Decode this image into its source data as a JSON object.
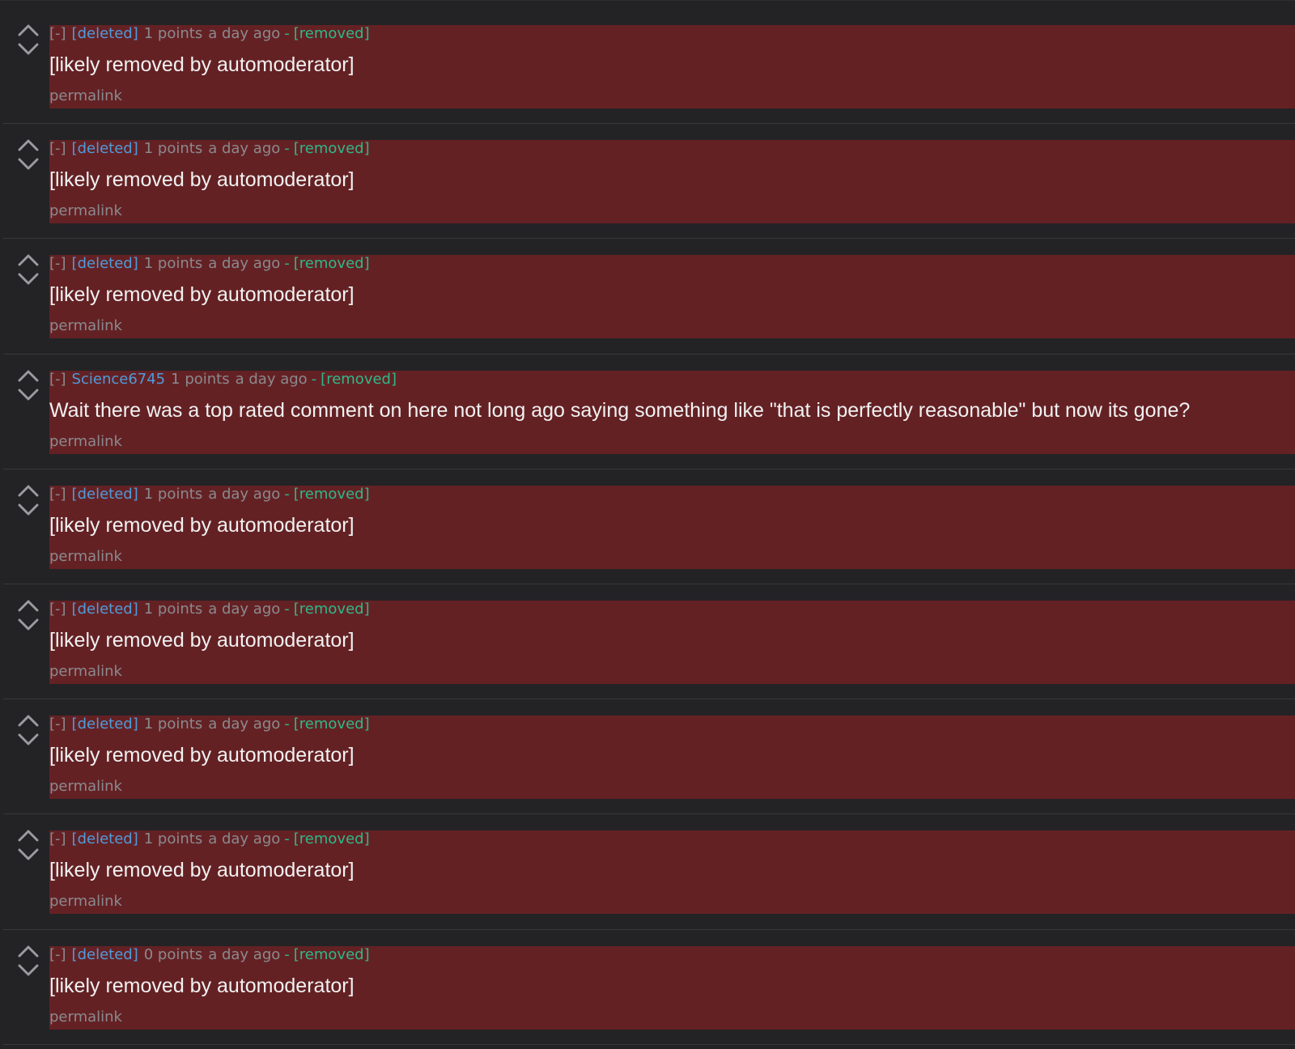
{
  "colors": {
    "page_background": "#232325",
    "removed_background": "#642124",
    "author_link": "#4f9bd9",
    "status_removed": "#2fb889",
    "meta_text": "#8a8a8e",
    "body_text": "#f1f1f1"
  },
  "comments": [
    {
      "expand": "[-]",
      "author": "[deleted]",
      "score": "1 points",
      "time": "a day ago",
      "dash": "-",
      "status": "[removed]",
      "text": "[likely removed by automoderator]",
      "permalink": "permalink"
    },
    {
      "expand": "[-]",
      "author": "[deleted]",
      "score": "1 points",
      "time": "a day ago",
      "dash": "-",
      "status": "[removed]",
      "text": "[likely removed by automoderator]",
      "permalink": "permalink"
    },
    {
      "expand": "[-]",
      "author": "[deleted]",
      "score": "1 points",
      "time": "a day ago",
      "dash": "-",
      "status": "[removed]",
      "text": "[likely removed by automoderator]",
      "permalink": "permalink"
    },
    {
      "expand": "[-]",
      "author": "Science6745",
      "score": "1 points",
      "time": "a day ago",
      "dash": "-",
      "status": "[removed]",
      "text": "Wait there was a top rated comment on here not long ago saying something like \"that is perfectly reasonable\" but now its gone?",
      "permalink": "permalink"
    },
    {
      "expand": "[-]",
      "author": "[deleted]",
      "score": "1 points",
      "time": "a day ago",
      "dash": "-",
      "status": "[removed]",
      "text": "[likely removed by automoderator]",
      "permalink": "permalink"
    },
    {
      "expand": "[-]",
      "author": "[deleted]",
      "score": "1 points",
      "time": "a day ago",
      "dash": "-",
      "status": "[removed]",
      "text": "[likely removed by automoderator]",
      "permalink": "permalink"
    },
    {
      "expand": "[-]",
      "author": "[deleted]",
      "score": "1 points",
      "time": "a day ago",
      "dash": "-",
      "status": "[removed]",
      "text": "[likely removed by automoderator]",
      "permalink": "permalink"
    },
    {
      "expand": "[-]",
      "author": "[deleted]",
      "score": "1 points",
      "time": "a day ago",
      "dash": "-",
      "status": "[removed]",
      "text": "[likely removed by automoderator]",
      "permalink": "permalink"
    },
    {
      "expand": "[-]",
      "author": "[deleted]",
      "score": "0 points",
      "time": "a day ago",
      "dash": "-",
      "status": "[removed]",
      "text": "[likely removed by automoderator]",
      "permalink": "permalink"
    }
  ]
}
